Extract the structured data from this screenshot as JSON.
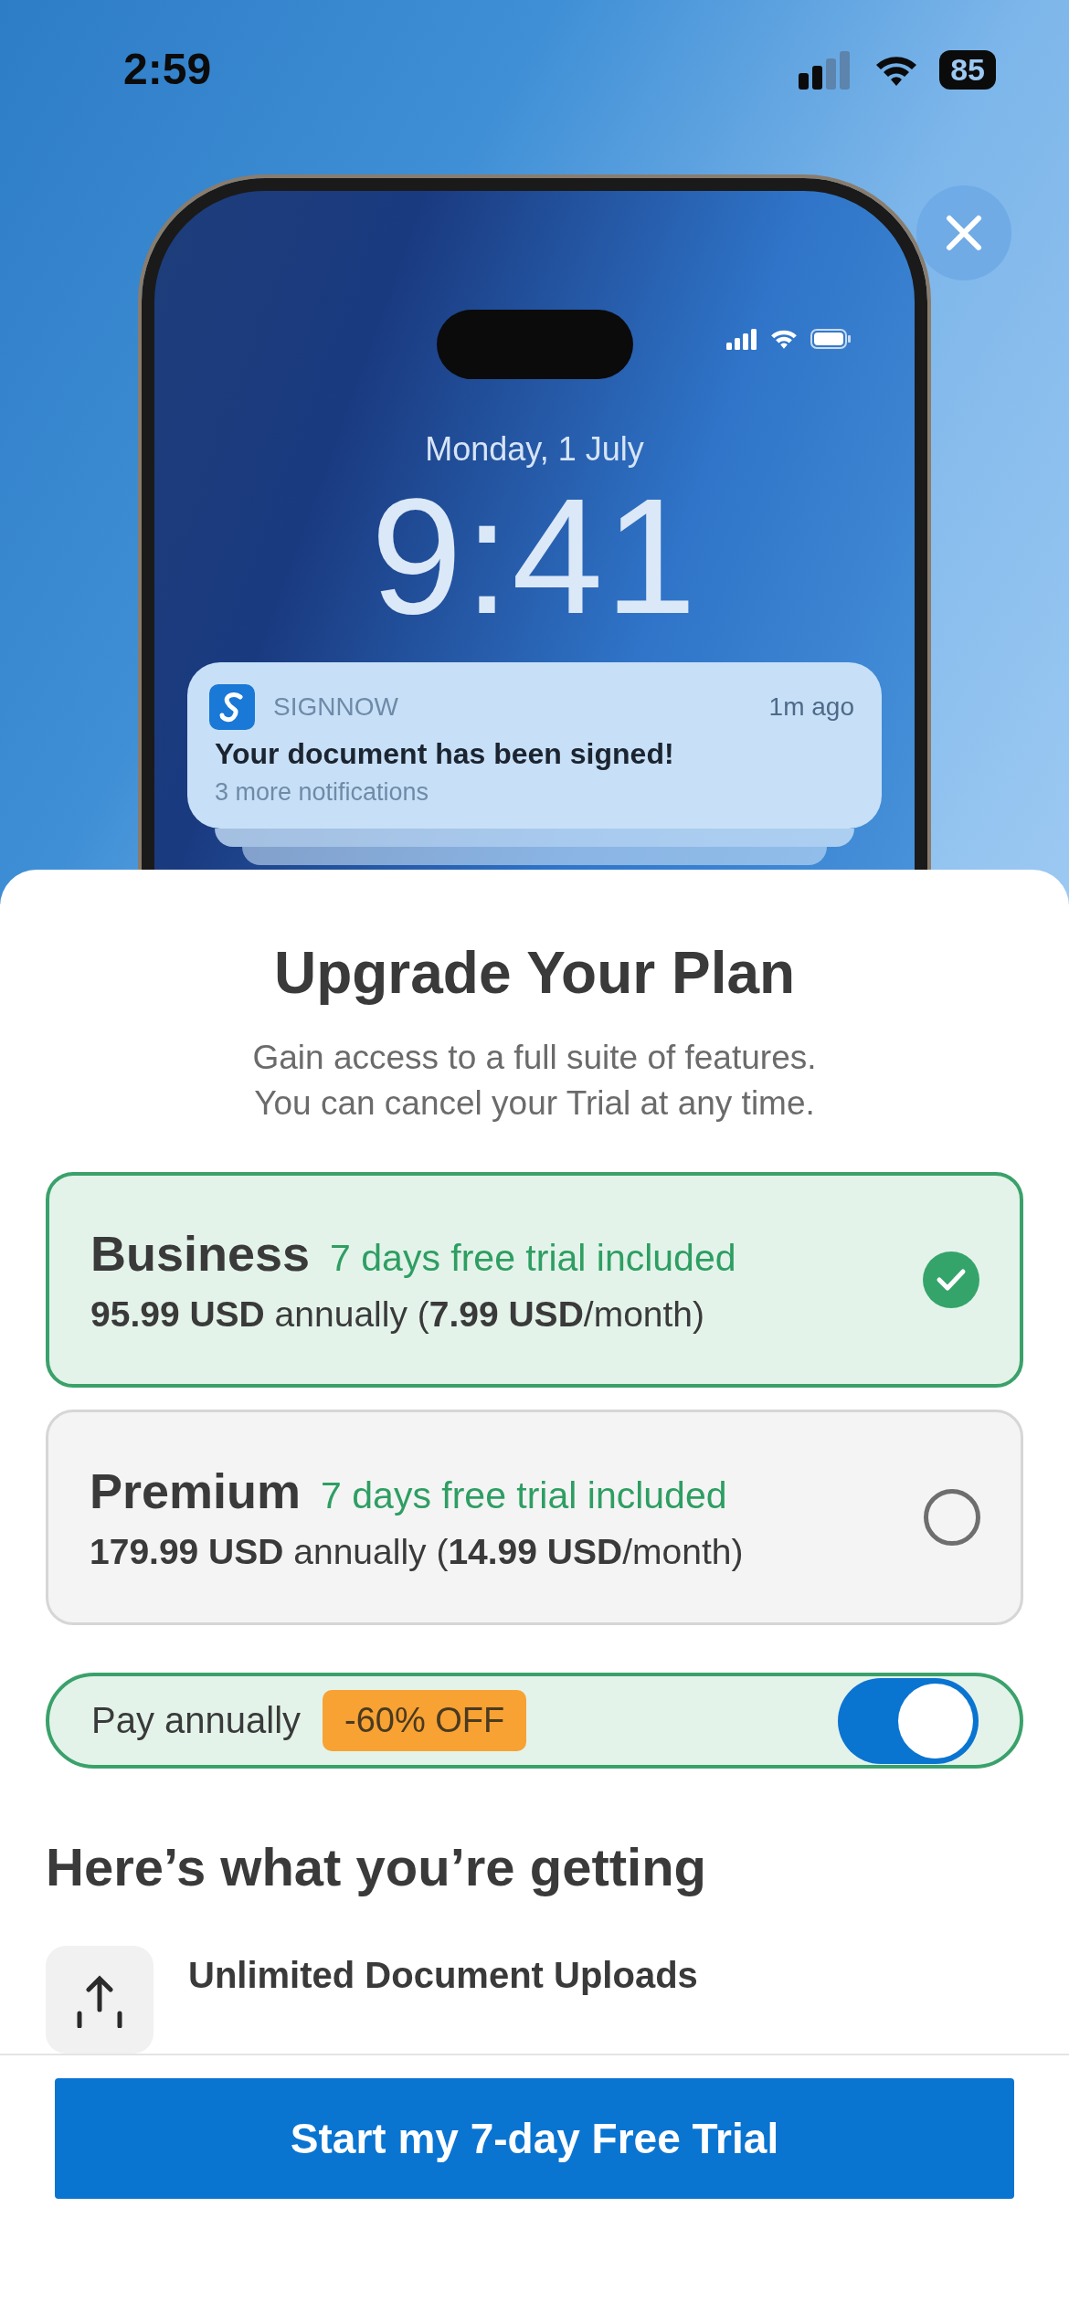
{
  "status_bar": {
    "time": "2:59",
    "battery": "85"
  },
  "hero": {
    "lock_screen": {
      "date": "Monday, 1 July",
      "time": "9:41",
      "notification": {
        "app": "SIGNNOW",
        "age": "1m ago",
        "title": "Your document has been signed!",
        "more": "3 more notifications"
      }
    }
  },
  "title": "Upgrade Your Plan",
  "subtitle": [
    "Gain access to a full suite of features.",
    "You can cancel your Trial at any time."
  ],
  "plans": [
    {
      "name": "Business",
      "trial": "7 days free trial included",
      "price": "**95.99 USD** annually (**7.99 USD**/month)",
      "selected": true
    },
    {
      "name": "Premium",
      "trial": "7 days free trial included",
      "price": "**179.99 USD** annually (**14.99 USD**/month)",
      "selected": false
    }
  ],
  "billing_toggle": {
    "label": "Pay annually",
    "badge": "-60% OFF",
    "on": true
  },
  "features_heading": "Here’s what you’re getting",
  "features": [
    {
      "title": "Unlimited Document Uploads"
    }
  ],
  "cta": "Start my 7-day Free Trial"
}
